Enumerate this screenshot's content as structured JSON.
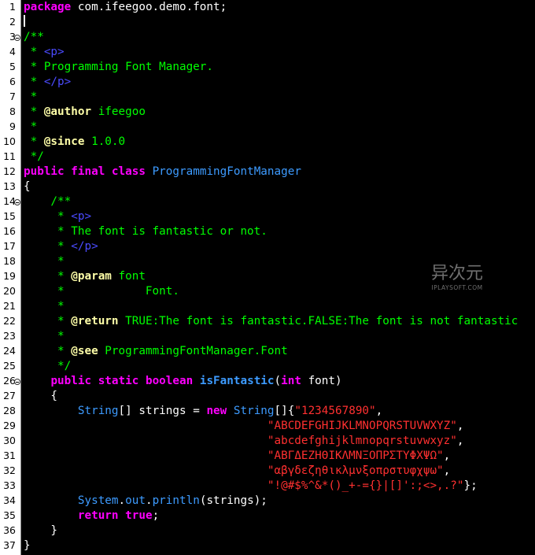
{
  "lines": [
    {
      "n": "1"
    },
    {
      "n": "2"
    },
    {
      "n": "3"
    },
    {
      "n": "4"
    },
    {
      "n": "5"
    },
    {
      "n": "6"
    },
    {
      "n": "7"
    },
    {
      "n": "8"
    },
    {
      "n": "9"
    },
    {
      "n": "10"
    },
    {
      "n": "11"
    },
    {
      "n": "12"
    },
    {
      "n": "13"
    },
    {
      "n": "14"
    },
    {
      "n": "15"
    },
    {
      "n": "16"
    },
    {
      "n": "17"
    },
    {
      "n": "18"
    },
    {
      "n": "19"
    },
    {
      "n": "20"
    },
    {
      "n": "21"
    },
    {
      "n": "22"
    },
    {
      "n": "23"
    },
    {
      "n": "24"
    },
    {
      "n": "25"
    },
    {
      "n": "26"
    },
    {
      "n": "27"
    },
    {
      "n": "28"
    },
    {
      "n": "29"
    },
    {
      "n": "30"
    },
    {
      "n": "31"
    },
    {
      "n": "32"
    },
    {
      "n": "33"
    },
    {
      "n": "34"
    },
    {
      "n": "35"
    },
    {
      "n": "36"
    },
    {
      "n": "37"
    }
  ],
  "code": {
    "l1_kw": "package",
    "l1_rest": " com.ifeegoo.demo.font;",
    "l3": "/**",
    "l4_a": " * ",
    "l4_tag": "<p>",
    "l5": " * Programming Font Manager.",
    "l6_a": " * ",
    "l6_tag": "</p>",
    "l7": " *",
    "l8_a": " * ",
    "l8_at": "@author",
    "l8_b": " ifeegoo",
    "l9": " *",
    "l10_a": " * ",
    "l10_at": "@since",
    "l10_b": " 1.0.0",
    "l11": " */",
    "l12_kw1": "public",
    "l12_kw2": "final",
    "l12_kw3": "class",
    "l12_cls": "ProgrammingFontManager",
    "l13": "{",
    "l14": "    /**",
    "l15_a": "     * ",
    "l15_tag": "<p>",
    "l16": "     * The font is fantastic or not.",
    "l17_a": "     * ",
    "l17_tag": "</p>",
    "l18": "     *",
    "l19_a": "     * ",
    "l19_at": "@param",
    "l19_b": " font",
    "l20": "     *            Font.",
    "l21": "     *",
    "l22_a": "     * ",
    "l22_at": "@return",
    "l22_b": " TRUE:The font is fantastic.FALSE:The font is not fantastic",
    "l23": "     *",
    "l24_a": "     * ",
    "l24_at": "@see",
    "l24_b": " ProgrammingFontManager.Font",
    "l25": "     */",
    "l26_kw1": "public",
    "l26_kw2": "static",
    "l26_kw3": "boolean",
    "l26_fn": "isFantastic",
    "l26_p1": "(",
    "l26_kw4": "int",
    "l26_p2": " font)",
    "l27": "    {",
    "l28_cls1": "String",
    "l28_mid": "[] strings = ",
    "l28_kw": "new",
    "l28_cls2": "String",
    "l28_br": "[]{",
    "l28_str": "\"1234567890\"",
    "l28_end": ",",
    "l29_str": "\"ABCDEFGHIJKLMNOPQRSTUVWXYZ\"",
    "l29_end": ",",
    "l30_str": "\"abcdefghijklmnopqrstuvwxyz\"",
    "l30_end": ",",
    "l31_str": "\"ΑΒΓΔΕΖΗΘΙΚΛΜΝΞΟΠΡΣΤΥΦΧΨΩ\"",
    "l31_end": ",",
    "l32_str": "\"αβγδεζηθικλμνξοπρστυφχψω\"",
    "l32_end": ",",
    "l33_str": "\"!@#$%^&*()_+-={}|[]':;<>,.?\"",
    "l33_end": "};",
    "l34_cls": "System",
    "l34_dot1": ".",
    "l34_out": "out",
    "l34_dot2": ".",
    "l34_m": "println",
    "l34_rest": "(strings);",
    "l35_kw": "return",
    "l35_true": "true",
    "l35_end": ";",
    "l36": "    }",
    "l37": "}"
  },
  "watermark": {
    "title": "异次元",
    "subtitle": "IPLAYSOFT.COM"
  },
  "colors": {
    "background": "#000000",
    "keyword": "#ff00ff",
    "comment": "#00ff00",
    "javadoc_tag": "#4b4bff",
    "annotation": "#ffffa8",
    "class": "#3d9bff",
    "string": "#ff3030"
  },
  "icons": {
    "fold_marker": "fold-collapse-icon"
  }
}
